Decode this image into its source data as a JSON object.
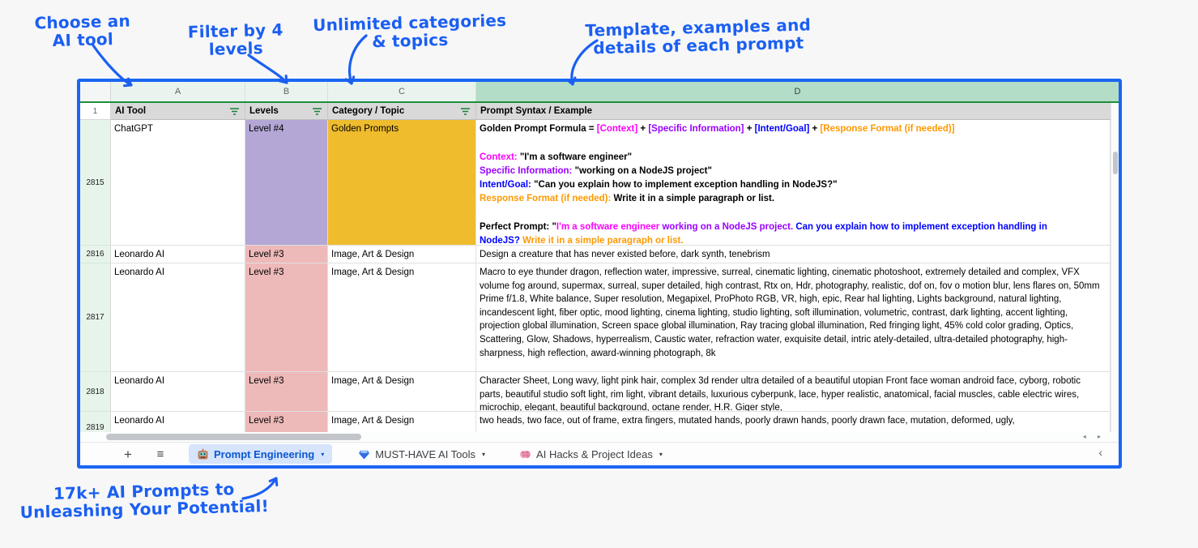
{
  "annotations": {
    "color": "#1b5ff2",
    "items": [
      {
        "name": "choose-ai-tool",
        "line1": "Choose an",
        "line2": "AI tool"
      },
      {
        "name": "filter-levels",
        "line1": "Filter by 4",
        "line2": "levels"
      },
      {
        "name": "unlimited-categories",
        "line1": "Unlimited categories",
        "line2": "& topics"
      },
      {
        "name": "template-details",
        "line1": "Template, examples and",
        "line2": "details of each prompt"
      },
      {
        "name": "prompts-count",
        "line1": "17k+ AI Prompts to",
        "line2": "Unleashing Your Potential!"
      }
    ]
  },
  "sheet": {
    "border_color": "#1a66f2",
    "column_letters": [
      "A",
      "B",
      "C",
      "D"
    ],
    "filter_row": {
      "row_number": "1",
      "headers": [
        "AI Tool",
        "Levels",
        "Category / Topic",
        "Prompt Syntax / Example"
      ]
    },
    "palette": {
      "magenta": "#ff00ff",
      "purple": "#9900ff",
      "blue": "#0000ff",
      "orange": "#ff9900",
      "black": "#000000",
      "level4_bg": "#b4a7d6",
      "level3_bg": "#eeb9b9",
      "gold_bg": "#eebc2d",
      "header_bg": "#d9d9d9",
      "rownum_bg": "#e7f4ea",
      "colD_header_bg": "#b3ddc6",
      "filter_icon_green": "#188038"
    },
    "rows": [
      {
        "n": "2815",
        "tool": "ChatGPT",
        "level": "Level #4",
        "category": "Golden Prompts"
      },
      {
        "n": "2816",
        "tool": "Leonardo AI",
        "level": "Level #3",
        "category": "Image, Art & Design",
        "prompt": "Design a creature that has never existed before, dark synth, tenebrism"
      },
      {
        "n": "2817",
        "tool": "Leonardo AI",
        "level": "Level #3",
        "category": "Image, Art & Design",
        "prompt": "Macro to eye thunder dragon, reflection water, impressive, surreal, cinematic lighting, cinematic photoshoot, extremely detailed and complex, VFX volume fog around, supermax, surreal, super detailed, high contrast, Rtx on, Hdr, photography, realistic, dof on, fov o motion blur, lens flares on, 50mm Prime f/1.8, White balance, Super resolution, Megapixel, ProPhoto RGB, VR, high, epic, Rear hal lighting, Lights background, natural lighting, incandescent light, fiber optic, mood lighting, cinema lighting, studio lighting, soft illumination, volumetric, contrast, dark lighting, accent lighting, projection global illumination, Screen space global illumination, Ray tracing global illumination, Red fringing light, 45% cold color grading, Optics, Scattering, Glow, Shadows, hyperrealism, Caustic water, refraction water, exquisite detail, intric ately-detailed, ultra-detailed photography, high-sharpness, high reflection, award-winning photograph, 8k"
      },
      {
        "n": "2818",
        "tool": "Leonardo AI",
        "level": "Level #3",
        "category": "Image, Art & Design",
        "prompt": "Character Sheet, Long wavy, light pink hair, complex 3d render ultra detailed of a beautiful utopian Front face woman android face, cyborg, robotic parts, beautiful studio soft light, rim light, vibrant details, luxurious cyberpunk, lace, hyper realistic, anatomical, facial muscles, cable electric wires, microchip, elegant, beautiful background, octane render, H.R. Giger style,"
      },
      {
        "n": "2819",
        "tool": "Leonardo AI",
        "level": "Level #3",
        "category": "Image, Art & Design",
        "prompt": "two heads, two face, out of frame, extra fingers, mutated hands, poorly drawn hands, poorly drawn face, mutation, deformed, ugly,"
      }
    ],
    "golden_prompt": [
      [
        {
          "t": "Golden Prompt Formula = ",
          "c": "black"
        },
        {
          "t": "[Context]",
          "c": "magenta"
        },
        {
          "t": " + ",
          "c": "black"
        },
        {
          "t": "[Specific Information]",
          "c": "purple"
        },
        {
          "t": " + ",
          "c": "black"
        },
        {
          "t": "[Intent/Goal]",
          "c": "blue"
        },
        {
          "t": " + ",
          "c": "black"
        },
        {
          "t": "[Response Format (if needed)]",
          "c": "orange"
        }
      ],
      [],
      [
        {
          "t": "Context: ",
          "c": "magenta"
        },
        {
          "t": "\"I'm a software engineer\"",
          "c": "black"
        }
      ],
      [
        {
          "t": "Specific Information: ",
          "c": "purple"
        },
        {
          "t": "\"working on a NodeJS project\"",
          "c": "black"
        }
      ],
      [
        {
          "t": "Intent/Goal: ",
          "c": "blue"
        },
        {
          "t": "\"Can you explain how to implement exception handling in NodeJS?\"",
          "c": "black"
        }
      ],
      [
        {
          "t": "Response Format (if needed): ",
          "c": "orange"
        },
        {
          "t": "Write it in a simple paragraph or list.",
          "c": "black"
        }
      ],
      [],
      [
        {
          "t": "Perfect Prompt: \"",
          "c": "black"
        },
        {
          "t": "I'm a software engineer",
          "c": "magenta"
        },
        {
          "t": " working on a NodeJS project.",
          "c": "purple"
        },
        {
          "t": " Can you explain how to implement exception handling in NodeJS?",
          "c": "blue"
        },
        {
          "t": " Write it in a simple paragraph or list.",
          "c": "orange"
        }
      ]
    ],
    "h_scroll_arrows": "◂ ▸"
  },
  "tabbar": {
    "add_label": "+",
    "menu_label": "≡",
    "caret": "▾",
    "scroll_left": "‹",
    "tabs": [
      {
        "icon": "robot-icon",
        "label": "Prompt Engineering",
        "active": true
      },
      {
        "icon": "gem-icon",
        "label": "MUST-HAVE AI Tools",
        "active": false
      },
      {
        "icon": "brain-icon",
        "label": "AI Hacks & Project Ideas",
        "active": false
      }
    ]
  }
}
